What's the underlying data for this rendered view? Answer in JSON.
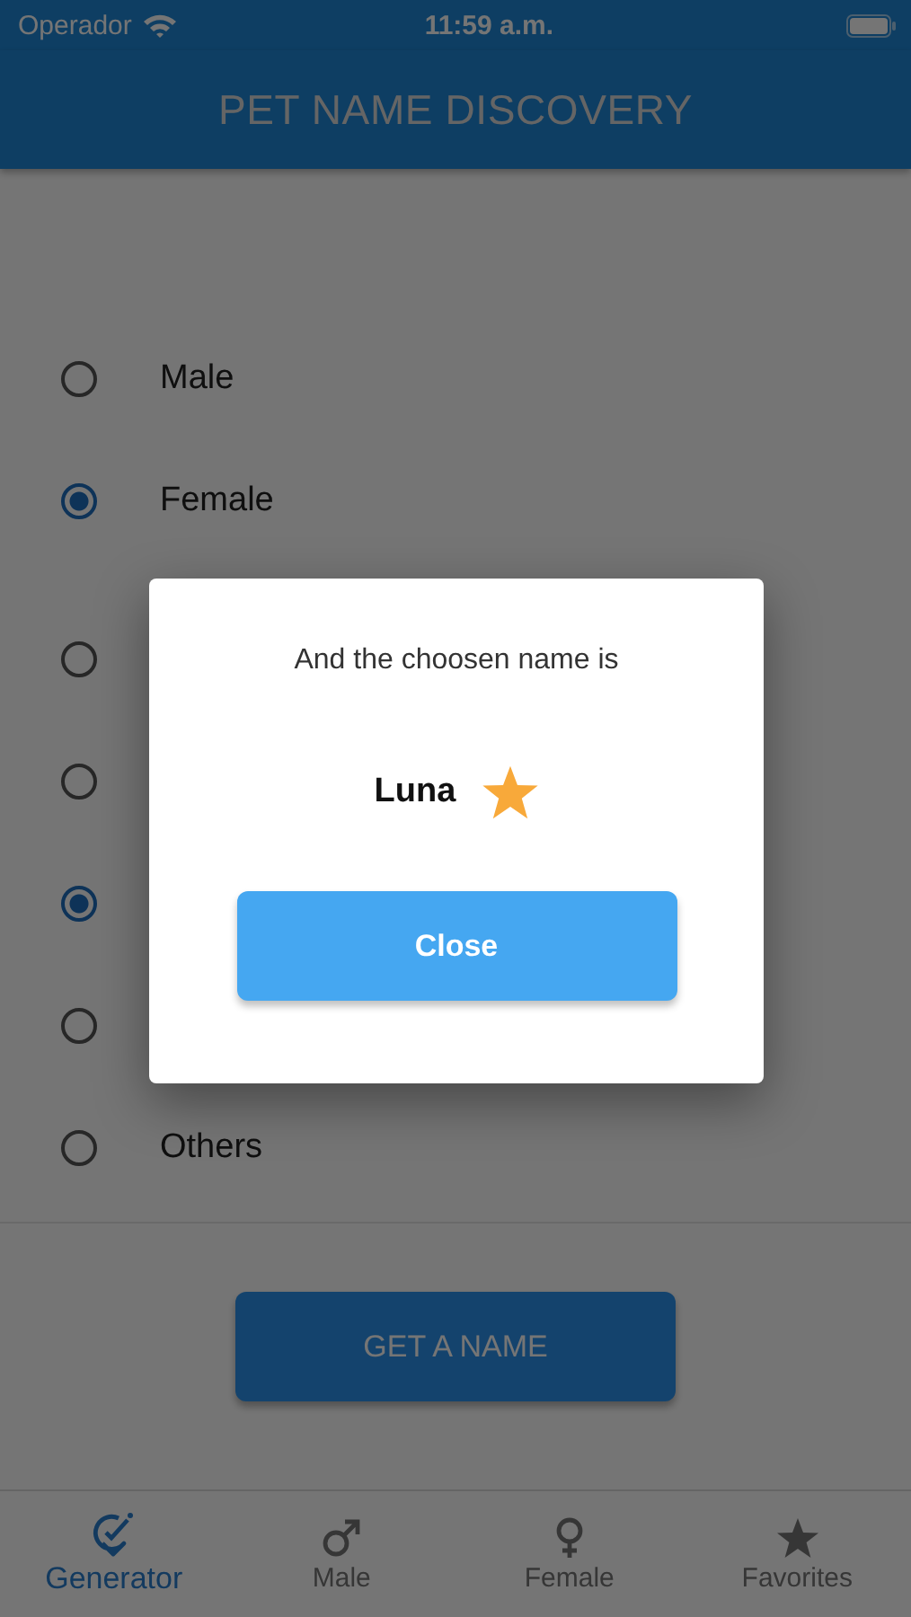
{
  "status_bar": {
    "carrier": "Operador",
    "time": "11:59 a.m."
  },
  "header": {
    "title": "PET NAME DISCOVERY"
  },
  "gender_options": [
    {
      "label": "Male",
      "selected": false
    },
    {
      "label": "Female",
      "selected": true
    }
  ],
  "category_options": [
    {
      "selected": false
    },
    {
      "selected": false
    },
    {
      "selected": true
    },
    {
      "selected": false
    },
    {
      "label": "Others",
      "selected": false
    }
  ],
  "get_name_button": "GET A NAME",
  "dialog": {
    "message": "And the choosen name is",
    "name": "Luna",
    "favorite": true,
    "close_button": "Close"
  },
  "tabs": [
    {
      "label": "Generator",
      "selected": true
    },
    {
      "label": "Male",
      "selected": false
    },
    {
      "label": "Female",
      "selected": false
    },
    {
      "label": "Favorites",
      "selected": false
    }
  ]
}
